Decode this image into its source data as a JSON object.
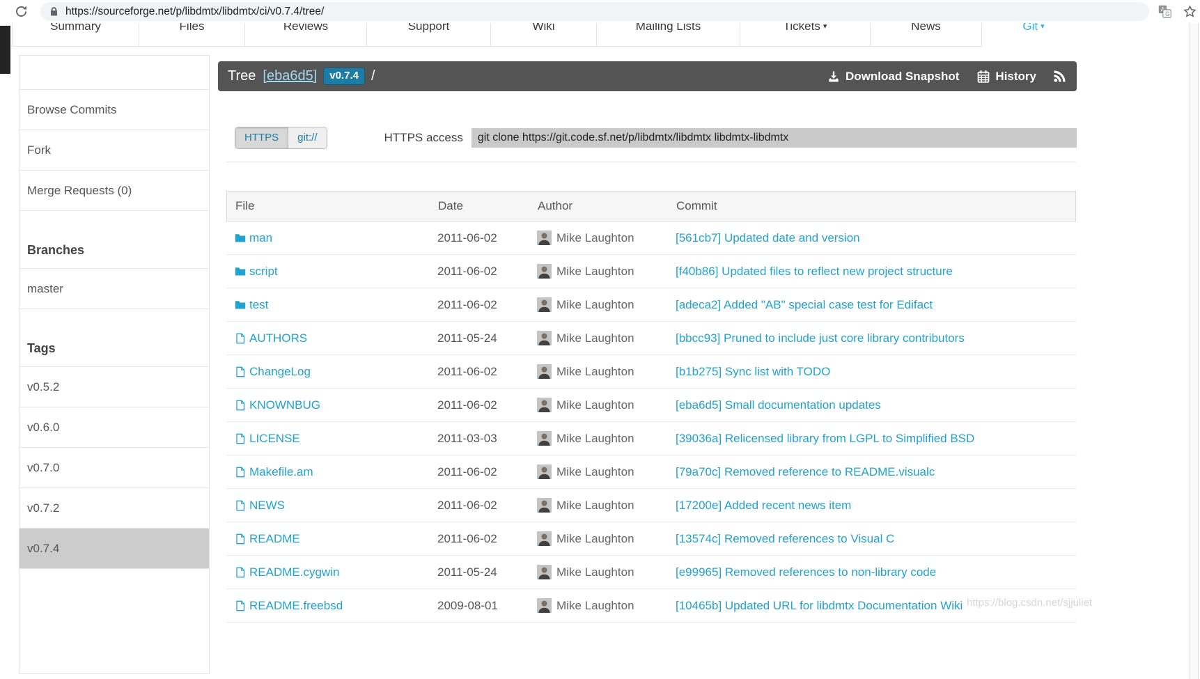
{
  "browser": {
    "url": "https://sourceforge.net/p/libdmtx/libdmtx/ci/v0.7.4/tree/"
  },
  "nav": {
    "tabs": [
      {
        "label": "Summary",
        "has_menu": false,
        "active": false
      },
      {
        "label": "Files",
        "has_menu": false,
        "active": false
      },
      {
        "label": "Reviews",
        "has_menu": false,
        "active": false
      },
      {
        "label": "Support",
        "has_menu": false,
        "active": false
      },
      {
        "label": "Wiki",
        "has_menu": false,
        "active": false
      },
      {
        "label": "Mailing Lists",
        "has_menu": false,
        "active": false
      },
      {
        "label": "Tickets",
        "has_menu": true,
        "active": false
      },
      {
        "label": "News",
        "has_menu": false,
        "active": false
      },
      {
        "label": "Git",
        "has_menu": true,
        "active": true
      }
    ]
  },
  "sidebar": {
    "links": [
      "Browse Commits",
      "Fork",
      "Merge Requests (0)"
    ],
    "sections": [
      {
        "title": "Branches",
        "items": [
          {
            "label": "master",
            "selected": false
          }
        ]
      },
      {
        "title": "Tags",
        "items": [
          {
            "label": "v0.5.2",
            "selected": false
          },
          {
            "label": "v0.6.0",
            "selected": false
          },
          {
            "label": "v0.7.0",
            "selected": false
          },
          {
            "label": "v0.7.2",
            "selected": false
          },
          {
            "label": "v0.7.4",
            "selected": true
          }
        ]
      }
    ]
  },
  "tree_header": {
    "title": "Tree",
    "commit_ref": "[eba6d5]",
    "tag": "v0.7.4",
    "path": "/",
    "download_label": "Download Snapshot",
    "history_label": "History"
  },
  "access": {
    "protocol_options": [
      "HTTPS",
      "git://"
    ],
    "selected_protocol": "HTTPS",
    "label": "HTTPS access",
    "clone_command": "git clone https://git.code.sf.net/p/libdmtx/libdmtx libdmtx-libdmtx"
  },
  "table": {
    "columns": [
      "File",
      "Date",
      "Author",
      "Commit"
    ],
    "rows": [
      {
        "icon": "folder-icon",
        "name": "man",
        "date": "2011-06-02",
        "author": "Mike Laughton",
        "commit": "[561cb7] Updated date and version"
      },
      {
        "icon": "folder-icon",
        "name": "script",
        "date": "2011-06-02",
        "author": "Mike Laughton",
        "commit": "[f40b86] Updated files to reflect new project structure"
      },
      {
        "icon": "folder-icon",
        "name": "test",
        "date": "2011-06-02",
        "author": "Mike Laughton",
        "commit": "[adeca2] Added \"AB\" special case test for Edifact"
      },
      {
        "icon": "file-icon",
        "name": "AUTHORS",
        "date": "2011-05-24",
        "author": "Mike Laughton",
        "commit": "[bbcc93] Pruned to include just core library contributors"
      },
      {
        "icon": "file-icon",
        "name": "ChangeLog",
        "date": "2011-06-02",
        "author": "Mike Laughton",
        "commit": "[b1b275] Sync list with TODO"
      },
      {
        "icon": "file-icon",
        "name": "KNOWNBUG",
        "date": "2011-06-02",
        "author": "Mike Laughton",
        "commit": "[eba6d5] Small documentation updates"
      },
      {
        "icon": "file-icon",
        "name": "LICENSE",
        "date": "2011-03-03",
        "author": "Mike Laughton",
        "commit": "[39036a] Relicensed library from LGPL to Simplified BSD"
      },
      {
        "icon": "file-icon",
        "name": "Makefile.am",
        "date": "2011-06-02",
        "author": "Mike Laughton",
        "commit": "[79a70c] Removed reference to README.visualc"
      },
      {
        "icon": "file-icon",
        "name": "NEWS",
        "date": "2011-06-02",
        "author": "Mike Laughton",
        "commit": "[17200e] Added recent news item"
      },
      {
        "icon": "file-icon",
        "name": "README",
        "date": "2011-06-02",
        "author": "Mike Laughton",
        "commit": "[13574c] Removed references to Visual C"
      },
      {
        "icon": "file-icon",
        "name": "README.cygwin",
        "date": "2011-05-24",
        "author": "Mike Laughton",
        "commit": "[e99965] Removed references to non-library code"
      },
      {
        "icon": "file-icon",
        "name": "README.freebsd",
        "date": "2009-08-01",
        "author": "Mike Laughton",
        "commit": "[10465b] Updated URL for libdmtx Documentation Wiki"
      }
    ]
  },
  "watermark": {
    "text": "https://blog.csdn.net/sjjuliet"
  },
  "colors": {
    "link": "#21a2d1",
    "tree_header_bg": "#545454",
    "badge_bg": "#1d7ca4",
    "selected_tag_bg": "#cccccc"
  }
}
